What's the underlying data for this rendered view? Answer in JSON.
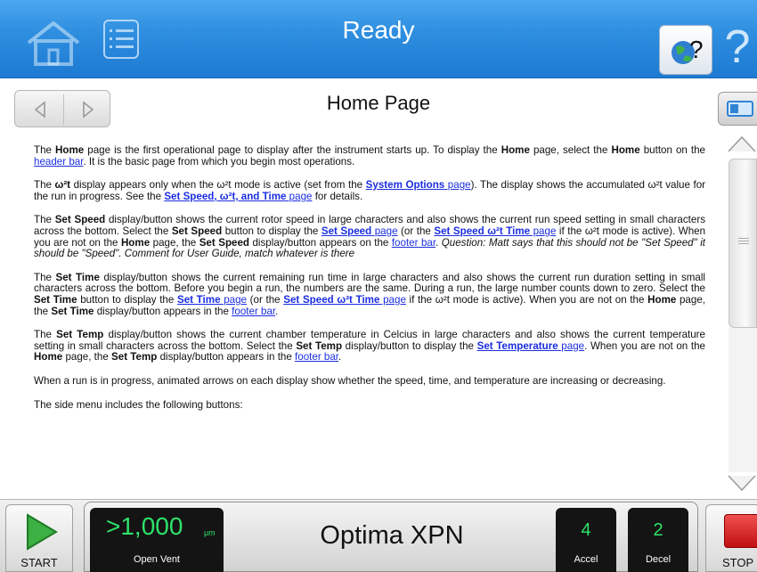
{
  "header": {
    "title": "Ready",
    "help_icon": "?"
  },
  "nav": {
    "page_title": "Home Page"
  },
  "content": {
    "p1": {
      "t1": "The ",
      "b1": "Home",
      "t2": " page is the first operational page to display after the instrument starts up. To display the ",
      "b2": "Home",
      "t3": " page, select the ",
      "b3": "Home",
      "t4": " button on the ",
      "link1": "header bar",
      "t5": ". It is the basic page from which you begin most operations."
    },
    "p2": {
      "t1": "The ",
      "b1": "ω²t",
      "t2": " display appears only when the ω²t mode is active (set from the ",
      "link1": "System Options",
      "link1_tail": " page",
      "t3": "). The display shows the accumulated ω²t value for the run in progress. See the ",
      "link2": "Set Speed, ω²t, and Time",
      "link2_tail": " page",
      "t4": " for details."
    },
    "p3": {
      "t1": "The ",
      "b1": "Set Speed",
      "t2": " display/button shows the current rotor speed in large characters and also shows the current run speed setting in small characters across the bottom. Select the ",
      "b2": "Set Speed",
      "t3": " button to display the ",
      "link1": "Set Speed",
      "link1_tail": " page",
      "t4": " (or the ",
      "link2": "Set Speed ω²t Time",
      "link2_tail": " page",
      "t5": " if the ω²t mode is active). When you are not on the ",
      "b3": "Home",
      "t6": " page, the ",
      "b4": "Set Speed",
      "t7": " display/button appears on the ",
      "link3": "footer bar",
      "t8": ". ",
      "note": "Question: Matt says that this should not be \"Set Speed\" it should be \"Speed\". Comment for User Guide, match whatever is there"
    },
    "p4": {
      "t1": "The ",
      "b1": "Set Time",
      "t2": " display/button shows the current remaining run time in large characters and also shows the current run duration setting in small characters across the bottom. Before you begin a run, the numbers are the same. During a run, the large number counts down to zero. Select the ",
      "b2": "Set Time",
      "t3": " button to display the ",
      "link1": "Set Time",
      "link1_tail": " page",
      "t4": " (or the ",
      "link2": "Set Speed ω²t Time",
      "link2_tail": " page",
      "t5": " if the ω²t mode is active). When you are not on the ",
      "b3": "Home",
      "t6": " page, the ",
      "b4": "Set Time",
      "t7": " display/button appears in the ",
      "link3": "footer bar",
      "t8": "."
    },
    "p5": {
      "t1": "The ",
      "b1": "Set Temp",
      "t2": " display/button shows the current chamber temperature in Celcius in large characters and also shows the current temperature setting in small characters across the bottom. Select the ",
      "b2": "Set Temp",
      "t3": " display/button to display the ",
      "link1": "Set Temperature",
      "link1_tail": " page",
      "t4": ". When you are not on the ",
      "b3": "Home",
      "t5": " page, the ",
      "b4": "Set Temp",
      "t6": " display/button appears in the ",
      "link2": "footer bar",
      "t7": "."
    },
    "p6": "When a run is in progress, animated arrows on each display show whether the speed, time, and temperature are increasing or decreasing.",
    "p7": "The side menu includes the following buttons:"
  },
  "footer": {
    "start_label": "START",
    "speed_value": ">1,000",
    "speed_unit": "μm",
    "speed_sub": "Open Vent",
    "model_name": "Optima XPN",
    "accel_value": "4",
    "accel_label": "Accel",
    "decel_value": "2",
    "decel_label": "Decel",
    "stop_label": "STOP"
  },
  "colors": {
    "header_blue": "#2f8fe0",
    "link_blue": "#1b2ee0",
    "display_green": "#2ee26a",
    "stop_red": "#d02020",
    "start_green": "#3cb043"
  }
}
